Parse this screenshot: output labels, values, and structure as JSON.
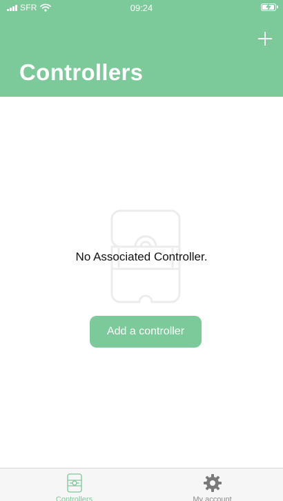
{
  "status_bar": {
    "carrier": "SFR",
    "time": "09:24",
    "battery_level": 0.9
  },
  "header": {
    "title": "Controllers"
  },
  "empty_state": {
    "message": "No Associated Controller.",
    "illustration_icon": "controller-outline-icon"
  },
  "actions": {
    "add_controller_label": "Add a controller",
    "add_icon": "plus-icon"
  },
  "tab_bar": {
    "tabs": [
      {
        "label": "Controllers",
        "icon": "controller-icon",
        "active": true
      },
      {
        "label": "My account",
        "icon": "gear-icon",
        "active": false
      }
    ]
  },
  "colors": {
    "accent": "#7cc99a",
    "tab_inactive": "#8a8a8a"
  }
}
